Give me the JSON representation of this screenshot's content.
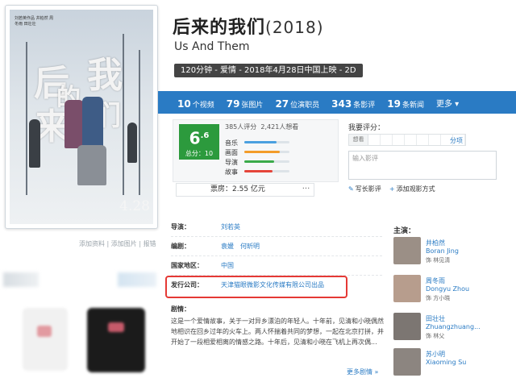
{
  "movie": {
    "title": "后来的我们",
    "year": "(2018)",
    "en_title": "Us And Them",
    "meta": "120分钟 - 爱情 - 2018年4月28日中国上映 - 2D"
  },
  "poster": {
    "title_chars": [
      "后",
      "的",
      "我",
      "来",
      "们"
    ],
    "credits": "刘若英作品 井柏然 周冬雨 田壮壮",
    "date": "4.28",
    "links": [
      "添加资料",
      "添加图片",
      "报错"
    ]
  },
  "stats": [
    {
      "num": "10",
      "label": "个视频"
    },
    {
      "num": "79",
      "label": "张图片"
    },
    {
      "num": "27",
      "label": "位演职员"
    },
    {
      "num": "343",
      "label": "条影评"
    },
    {
      "num": "19",
      "label": "条新闻"
    }
  ],
  "stats_more": "更多",
  "rating": {
    "score": "6",
    "score_decimal": ".6",
    "total": "总分：10",
    "raters": "385人评分",
    "want": "2,421人想看",
    "aspects": [
      {
        "label": "音乐",
        "value": 0.72,
        "color": "#4aa0e0"
      },
      {
        "label": "画面",
        "value": 0.78,
        "color": "#f39c2a"
      },
      {
        "label": "导演",
        "value": 0.66,
        "color": "#3bab4a"
      },
      {
        "label": "故事",
        "value": 0.62,
        "color": "#e5453a"
      }
    ],
    "boxoffice": "票房：2.55 亿元",
    "more_btn": "···"
  },
  "my_rating": {
    "label": "我要评分：",
    "stars_label": "想看",
    "score_label": "分项",
    "review_placeholder": "输入影评",
    "write_review": "写长影评",
    "add_tag": "添加观影方式"
  },
  "info": {
    "director_label": "导演：",
    "directors": [
      "刘若英"
    ],
    "writer_label": "编剧：",
    "writers": [
      "袁媛",
      "何昕明"
    ],
    "country_label": "国家地区：",
    "countries": [
      "中国"
    ],
    "distributor_label": "发行公司：",
    "distributors": [
      "天津猫眼微影文化传媒有限公司出品"
    ],
    "plot_label": "剧情：",
    "plot": "这是一个爱情故事，关于一对异乡漂泊的年轻人。十年前，见清和小晓偶然地相识在回乡过年的火车上。两人怀揣着共同的梦想，一起在北京打拼，并开始了一段相爱相离的情感之路。十年后，见清和小晓在飞机上再次偶...",
    "more_stills": "更多剧情 »"
  },
  "cast": {
    "title": "主演：",
    "members": [
      {
        "cn": "井柏然",
        "en": "Boran Jing",
        "role": "饰 林见清",
        "color": "#9b8f86"
      },
      {
        "cn": "周冬雨",
        "en": "Dongyu Zhou",
        "role": "饰 方小晓",
        "color": "#b79d8d"
      },
      {
        "cn": "田壮壮",
        "en": "Zhuangzhuang...",
        "role": "饰 林父",
        "color": "#7c7672"
      },
      {
        "cn": "苏小明",
        "en": "Xiaoming Su",
        "role": "",
        "color": "#8c8580"
      }
    ]
  }
}
